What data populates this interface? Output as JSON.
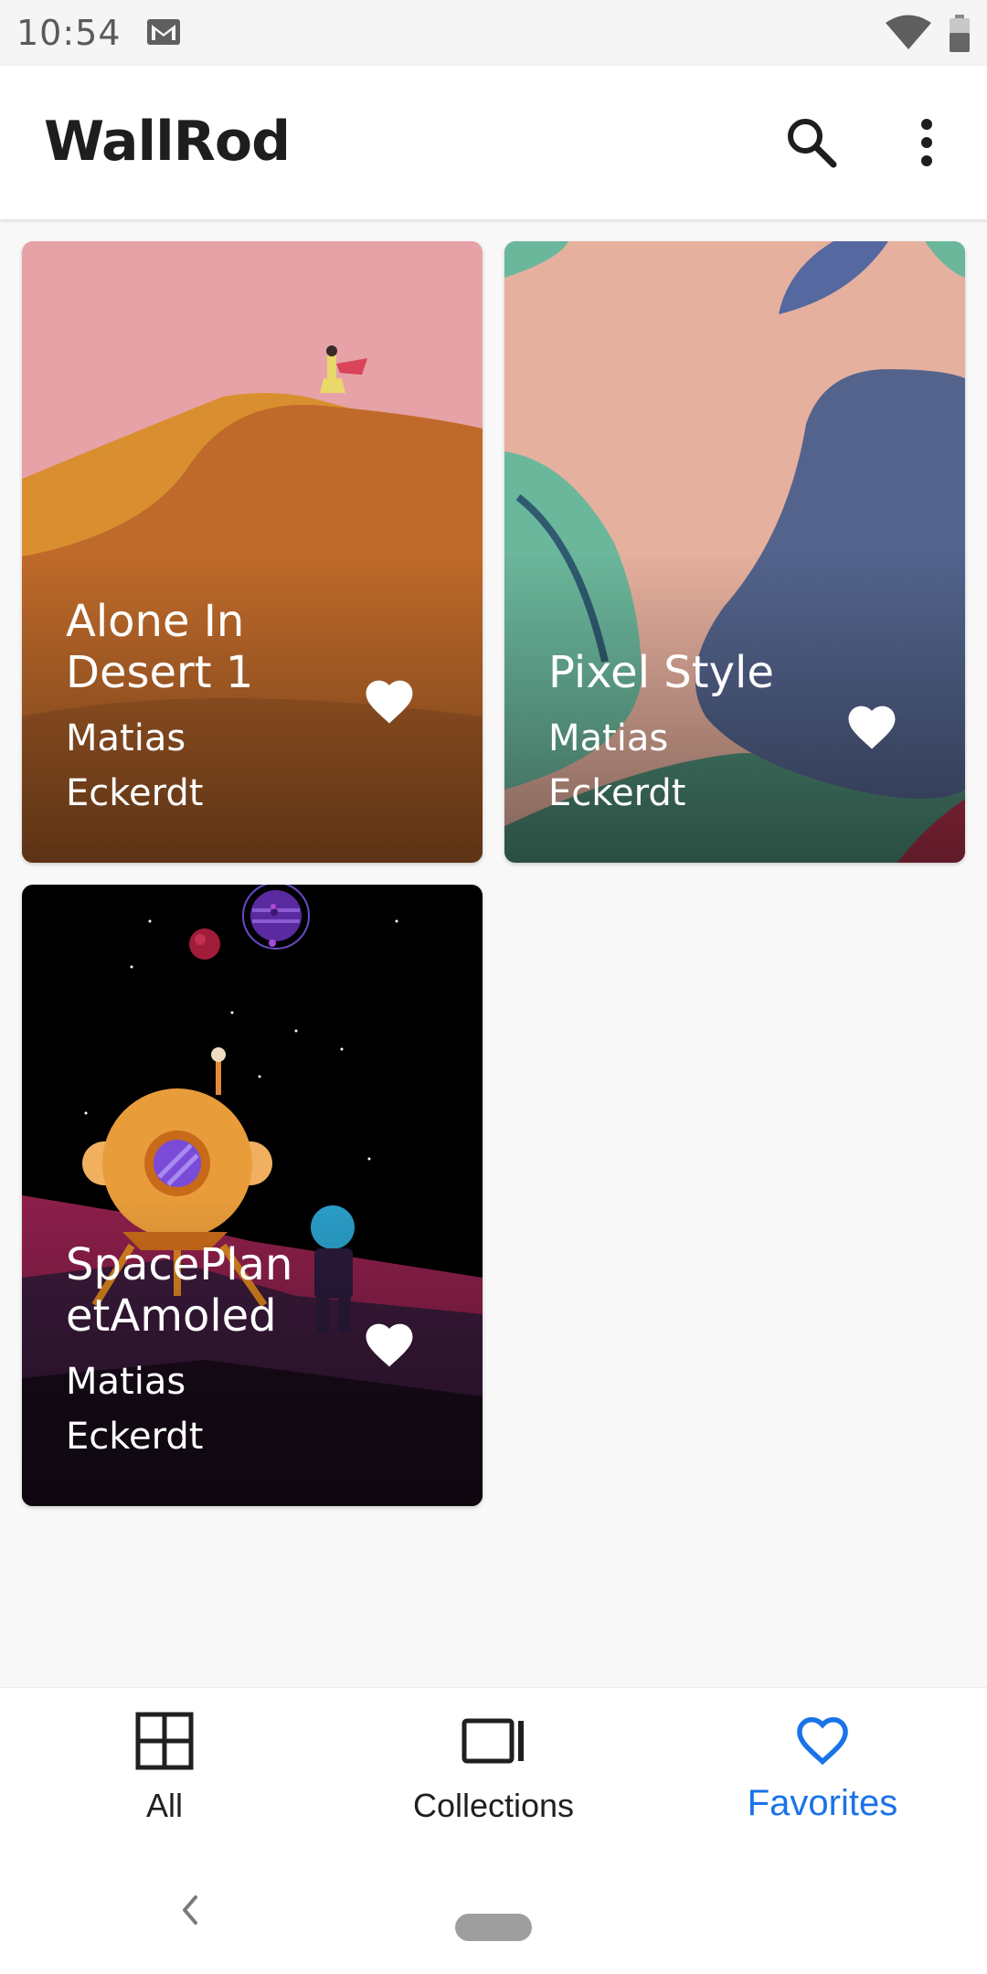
{
  "status_bar": {
    "time": "10:54",
    "icons": [
      "gmail-icon",
      "wifi-icon",
      "battery-icon"
    ]
  },
  "app_bar": {
    "title": "WallRod",
    "actions": [
      "search-icon",
      "more-vert-icon"
    ]
  },
  "wallpapers": [
    {
      "title": "Alone In Desert 1",
      "title_lines": [
        "Alone In",
        "Desert 1"
      ],
      "author_lines": [
        "Matias",
        "Eckerdt"
      ],
      "favorited": true
    },
    {
      "title": "Pixel Style",
      "title_lines": [
        "Pixel Style"
      ],
      "author_lines": [
        "Matias",
        "Eckerdt"
      ],
      "favorited": true
    },
    {
      "title": "SpacePlanetAmoled",
      "title_lines": [
        "SpacePlan",
        "etAmoled"
      ],
      "author_lines": [
        "Matias",
        "Eckerdt"
      ],
      "favorited": true
    }
  ],
  "bottom_nav": {
    "items": [
      {
        "label": "All",
        "icon": "grid-icon",
        "active": false
      },
      {
        "label": "Collections",
        "icon": "collections-icon",
        "active": false
      },
      {
        "label": "Favorites",
        "icon": "heart-outline-icon",
        "active": true
      }
    ]
  },
  "colors": {
    "accent": "#1a73e8",
    "app_bar": "#ffffff",
    "background": "#f8f8f8"
  }
}
